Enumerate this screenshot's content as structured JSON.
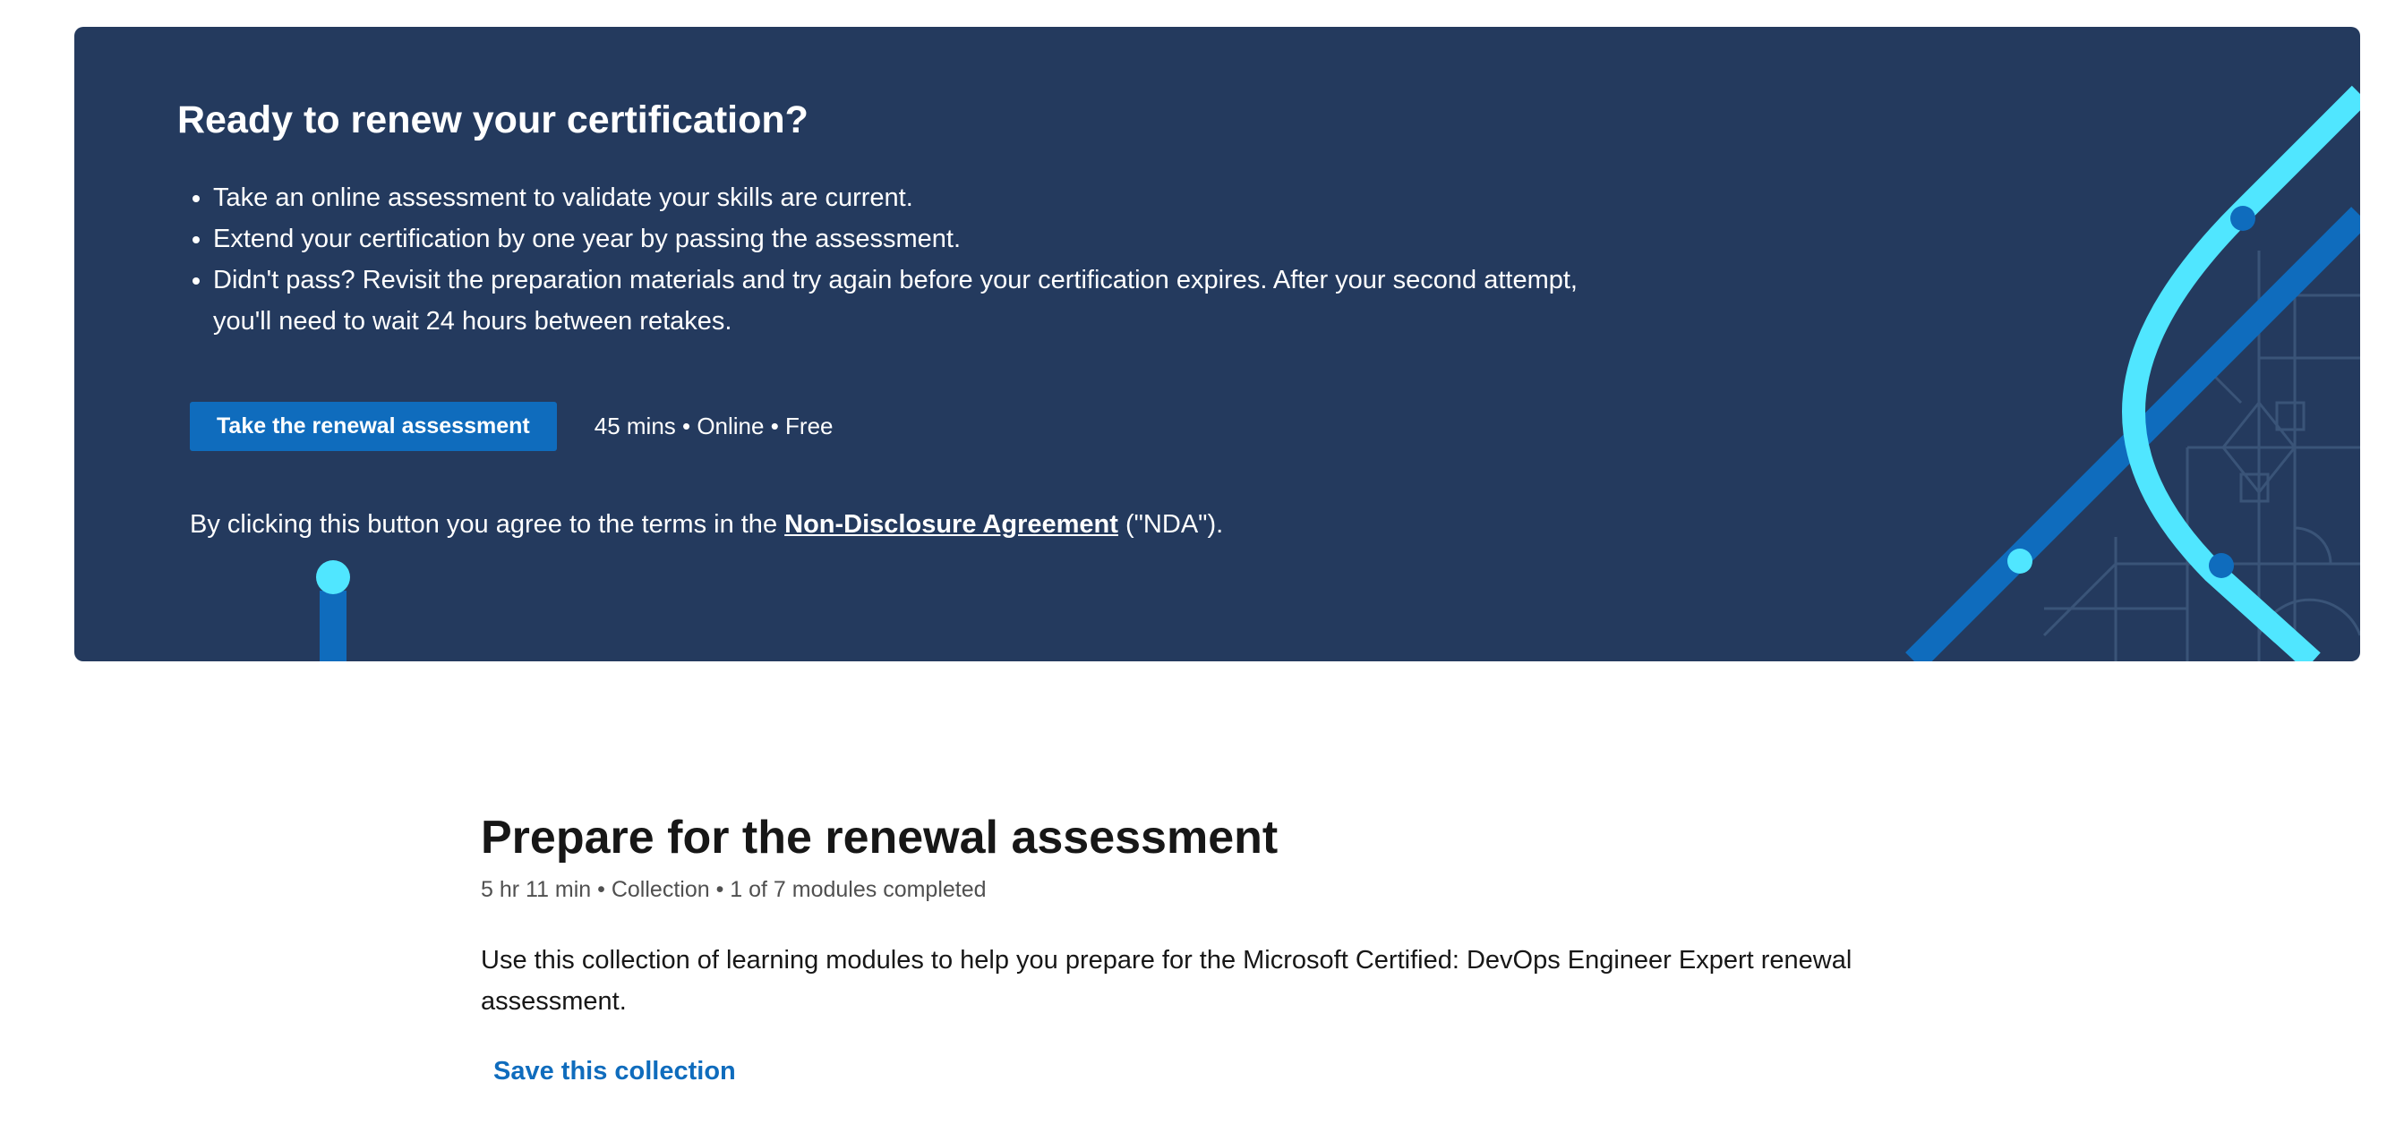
{
  "hero": {
    "title": "Ready to renew your certification?",
    "bullets": [
      "Take an online assessment to validate your skills are current.",
      "Extend your certification by one year by passing the assessment.",
      "Didn't pass? Revisit the preparation materials and try again before your certification expires. After your second attempt, you'll need to wait 24 hours between retakes."
    ],
    "cta_label": "Take the renewal assessment",
    "cta_meta": "45 mins • Online • Free",
    "nda_prefix": "By clicking this button you agree to the terms in the ",
    "nda_link": "Non-Disclosure Agreement",
    "nda_suffix": " (\"NDA\").",
    "colors": {
      "background": "#243a5e",
      "button": "#0f6cbd",
      "accent_light": "#50e6ff",
      "accent_dark": "#0f6cbd"
    }
  },
  "collection": {
    "title": "Prepare for the renewal assessment",
    "meta": "5 hr 11 min • Collection • 1 of 7 modules completed",
    "description": "Use this collection of learning modules to help you prepare for the Microsoft Certified: DevOps Engineer Expert renewal assessment.",
    "save_label": "Save this collection"
  }
}
